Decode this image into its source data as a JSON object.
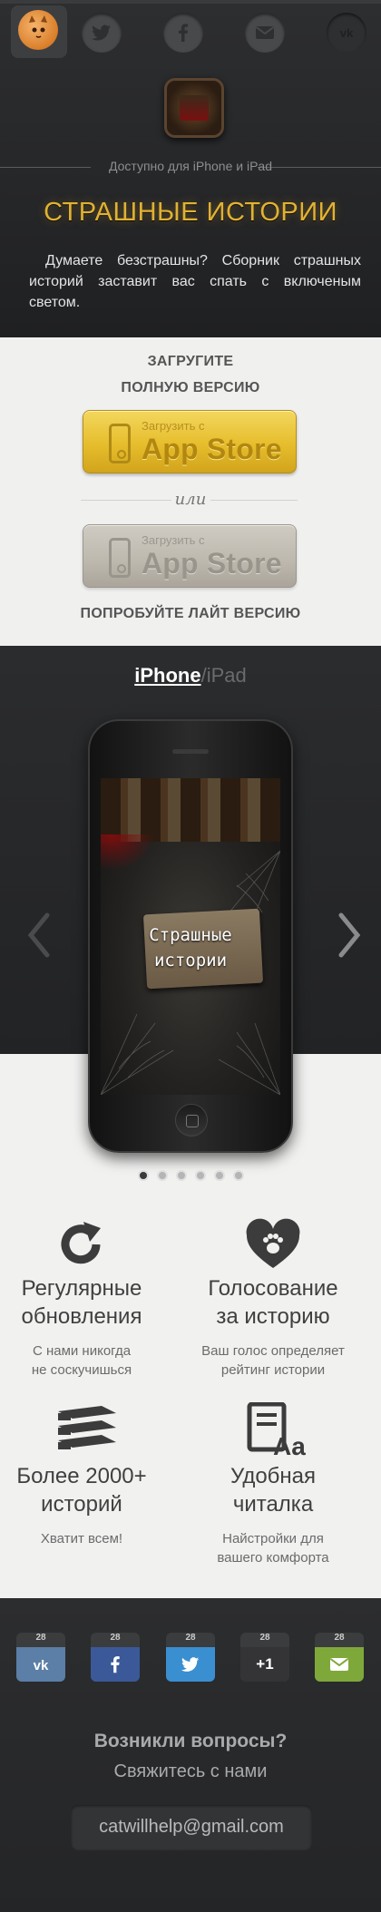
{
  "nav": {
    "items": [
      {
        "icon": "cat-logo-icon"
      },
      {
        "icon": "twitter-icon"
      },
      {
        "icon": "facebook-icon"
      },
      {
        "icon": "mail-icon"
      },
      {
        "icon": "vk-icon"
      }
    ]
  },
  "hero": {
    "available": "Доступно для iPhone и iPad",
    "title": "СТРАШНЫЕ ИСТОРИИ",
    "description": "Думаете безстрашны? Сборник страшных историй заставит вас спать с включеным светом."
  },
  "download": {
    "full_line1": "ЗАГРУГИТЕ",
    "full_line2": "ПОЛНУЮ ВЕРСИЮ",
    "store_small": "Загрузить с",
    "store_big": "App Store",
    "or": "или",
    "lite_label": "ПОПРОБУЙТЕ ЛАЙТ ВЕРСИЮ"
  },
  "showcase": {
    "tab_iphone": "iPhone",
    "tab_sep": "/",
    "tab_ipad": "iPad",
    "screen_title_line1": "Страшные",
    "screen_title_line2": "истории",
    "slides_total": 6,
    "slide_active": 1
  },
  "features": [
    {
      "icon": "refresh-icon",
      "title_l1": "Регулярные",
      "title_l2": "обновления",
      "sub_l1": "С нами никогда",
      "sub_l2": "не соскучишься"
    },
    {
      "icon": "heart-paw-icon",
      "title_l1": "Голосование",
      "title_l2": "за историю",
      "sub_l1": "Ваш голос определяет",
      "sub_l2": "рейтинг истории"
    },
    {
      "icon": "books-icon",
      "title_l1": "Более 2000+",
      "title_l2": "историй",
      "sub_l1": "Хватит всем!",
      "sub_l2": ""
    },
    {
      "icon": "reader-icon",
      "title_l1": "Удобная",
      "title_l2": "читалка",
      "sub_l1": "Найстройки для",
      "sub_l2": "вашего  комфорта"
    }
  ],
  "share": {
    "items": [
      {
        "count": "28",
        "label": "",
        "color": "#5b7fa6",
        "icon": "vk-icon"
      },
      {
        "count": "28",
        "label": "",
        "color": "#3b5998",
        "icon": "facebook-icon"
      },
      {
        "count": "28",
        "label": "",
        "color": "#3a8fd1",
        "icon": "twitter-icon"
      },
      {
        "count": "28",
        "label": "+1",
        "color": "#3a3a3a",
        "icon": "google-plus-icon"
      },
      {
        "count": "28",
        "label": "",
        "color": "#7fa83a",
        "icon": "mail-icon"
      }
    ]
  },
  "contact": {
    "question": "Возникли вопросы?",
    "cta": "Свяжитесь с нами",
    "email": "catwillhelp@gmail.com"
  },
  "colors": {
    "accent_gold": "#e0b233",
    "store_gold": "#e6bd2c",
    "store_grey": "#bdb8ae",
    "dark_bg": "#2b2c2e",
    "light_bg": "#f0f0ef"
  }
}
